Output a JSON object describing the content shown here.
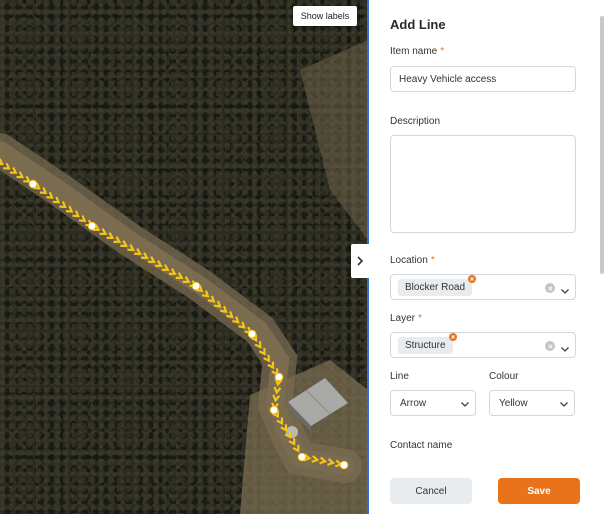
{
  "map": {
    "show_labels_label": "Show labels"
  },
  "panel": {
    "title": "Add Line",
    "item_name": {
      "label": "Item name",
      "required_mark": "*",
      "value": "Heavy Vehicle access"
    },
    "description": {
      "label": "Description",
      "value": ""
    },
    "location": {
      "label": "Location",
      "required_mark": "*",
      "selected": "Blocker Road"
    },
    "layer": {
      "label": "Layer",
      "required_mark": "*",
      "selected": "Structure"
    },
    "line": {
      "label": "Line",
      "selected": "Arrow"
    },
    "colour": {
      "label": "Colour",
      "selected": "Yellow"
    },
    "contact_name": {
      "label": "Contact name"
    },
    "cancel_label": "Cancel",
    "save_label": "Save"
  },
  "colors": {
    "accent": "#e8731a",
    "divider": "#2e6fd6",
    "route": "#f5c518"
  },
  "icons": {
    "collapse": "chevron-right-icon",
    "dropdown": "chevron-down-icon",
    "clear": "clear-x-icon",
    "chip_remove": "x-icon"
  }
}
